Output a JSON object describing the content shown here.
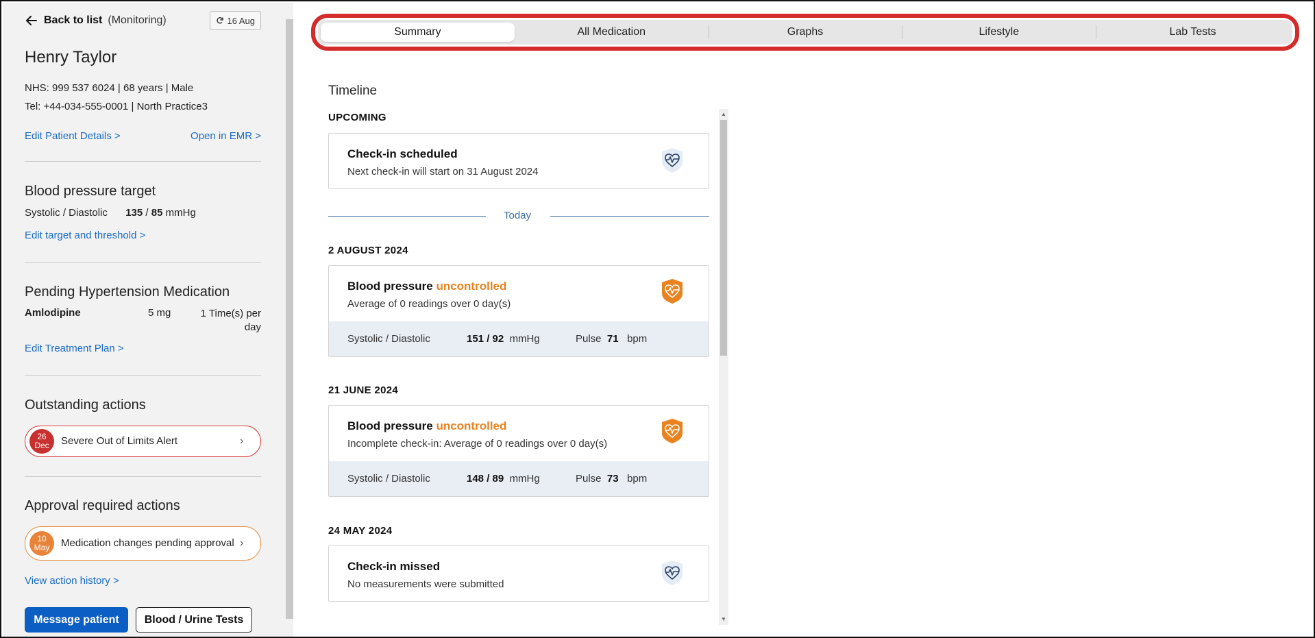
{
  "sidebar": {
    "back_label": "Back to list",
    "status_label": "(Monitoring)",
    "date_button": "16 Aug",
    "patient_name": "Henry Taylor",
    "nhs_line": "NHS: 999 537 6024  |  68 years  |  Male",
    "tel_line": "Tel: +44-034-555-0001  |  North Practice3",
    "edit_details_link": "Edit Patient Details >",
    "open_emr_link": "Open in EMR >",
    "bp_target": {
      "title": "Blood pressure target",
      "label": "Systolic / Diastolic",
      "systolic": "135",
      "separator": "/",
      "diastolic": "85",
      "unit": "mmHg",
      "edit_link": "Edit target and threshold >"
    },
    "pending_med": {
      "title": "Pending Hypertension Medication",
      "name": "Amlodipine",
      "dose": "5 mg",
      "frequency": "1 Time(s) per day",
      "edit_link": "Edit Treatment Plan >"
    },
    "outstanding": {
      "title": "Outstanding actions",
      "badge_day": "26",
      "badge_month": "Dec",
      "label": "Severe Out of Limits Alert"
    },
    "approval": {
      "title": "Approval required actions",
      "badge_day": "10",
      "badge_month": "May",
      "label": "Medication changes pending approval"
    },
    "history_link": "View action history >",
    "message_button": "Message patient",
    "tests_button": "Blood / Urine Tests"
  },
  "tabs": [
    "Summary",
    "All Medication",
    "Graphs",
    "Lifestyle",
    "Lab Tests"
  ],
  "active_tab": "Summary",
  "timeline": {
    "title": "Timeline",
    "upcoming_header": "UPCOMING",
    "today_label": "Today",
    "checkin": {
      "title": "Check-in scheduled",
      "subtitle": "Next check-in will start on 31 August 2024"
    },
    "entries": [
      {
        "date": "2 AUGUST 2024",
        "title_prefix": "Blood pressure",
        "title_status": "uncontrolled",
        "subtitle": "Average of 0 readings over 0 day(s)",
        "stat_label": "Systolic / Diastolic",
        "bp_value": "151 / 92",
        "bp_unit": "mmHg",
        "pulse_label": "Pulse",
        "pulse_value": "71",
        "pulse_unit": "bpm"
      },
      {
        "date": "21 JUNE 2024",
        "title_prefix": "Blood pressure",
        "title_status": "uncontrolled",
        "subtitle": "Incomplete check-in: Average of 0 readings over 0 day(s)",
        "stat_label": "Systolic / Diastolic",
        "bp_value": "148 / 89",
        "bp_unit": "mmHg",
        "pulse_label": "Pulse",
        "pulse_value": "73",
        "pulse_unit": "bpm"
      }
    ],
    "missed": {
      "date": "24 MAY 2024",
      "title": "Check-in missed",
      "subtitle": "No measurements were submitted"
    }
  },
  "colors": {
    "link": "#1a6bc4",
    "warning": "#e8831f",
    "alert_red": "#c8312f",
    "primary_button": "#0b5ec4",
    "highlight_ring": "#d42b2b"
  }
}
